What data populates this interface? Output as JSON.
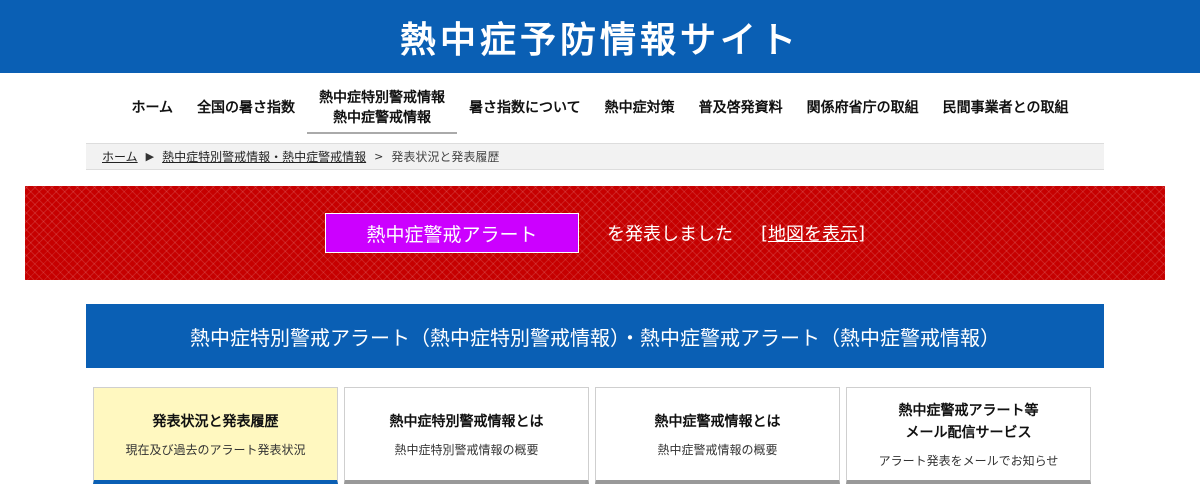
{
  "site": {
    "title": "熱中症予防情報サイト"
  },
  "nav": {
    "items": [
      {
        "label": "ホーム"
      },
      {
        "label": "全国の暑さ指数"
      },
      {
        "label_line1": "熱中症特別警戒情報",
        "label_line2": "熱中症警戒情報"
      },
      {
        "label": "暑さ指数について"
      },
      {
        "label": "熱中症対策"
      },
      {
        "label": "普及啓発資料"
      },
      {
        "label": "関係府省庁の取組"
      },
      {
        "label": "民間事業者との取組"
      }
    ]
  },
  "breadcrumb": {
    "home": "ホーム",
    "sep1": "▶",
    "level2": "熱中症特別警戒情報・熱中症警戒情報",
    "sep2": ">",
    "current": "発表状況と発表履歴"
  },
  "alert": {
    "badge": "熱中症警戒アラート",
    "text": "を発表しました",
    "bracket_open": "[",
    "link": "地図を表示",
    "bracket_close": "]",
    "badge_color": "#cc00ff",
    "banner_color": "#c60000"
  },
  "section": {
    "title": "熱中症特別警戒アラート（熱中症特別警戒情報）・熱中症警戒アラート（熱中症警戒情報）"
  },
  "cards": [
    {
      "title": "発表状況と発表履歴",
      "sub": "現在及び過去のアラート発表状況"
    },
    {
      "title": "熱中症特別警戒情報とは",
      "sub": "熱中症特別警戒情報の概要"
    },
    {
      "title": "熱中症警戒情報とは",
      "sub": "熱中症警戒情報の概要"
    },
    {
      "title_line1": "熱中症警戒アラート等",
      "title_line2": "メール配信サービス",
      "sub": "アラート発表をメールでお知らせ"
    }
  ],
  "colors": {
    "brand_blue": "#0a5fb4",
    "active_card": "#fff8c0"
  }
}
